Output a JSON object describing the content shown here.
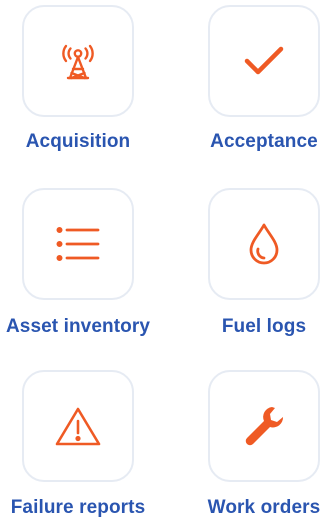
{
  "accent_color": "#ef5a24",
  "label_color": "#2a55b0",
  "items": [
    {
      "label": "Acquisition",
      "icon": "antenna-tower-icon"
    },
    {
      "label": "Acceptance",
      "icon": "checkmark-icon"
    },
    {
      "label": "Asset inventory",
      "icon": "list-icon"
    },
    {
      "label": "Fuel logs",
      "icon": "fuel-drop-icon"
    },
    {
      "label": "Failure reports",
      "icon": "warning-triangle-icon"
    },
    {
      "label": "Work orders",
      "icon": "wrench-icon"
    }
  ]
}
